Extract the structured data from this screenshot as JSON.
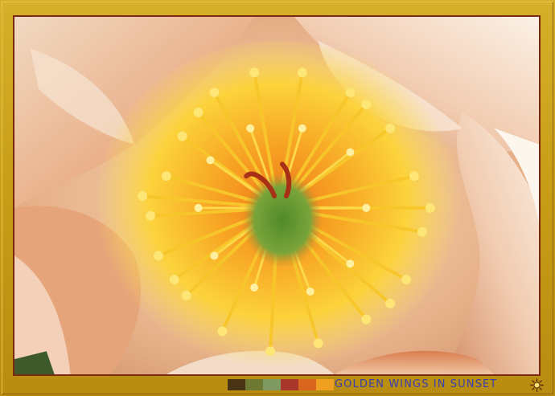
{
  "caption": {
    "text": "GOLDEN WINGS IN SUNSET",
    "color": "#3a3fb0"
  },
  "palette": [
    "#4a3214",
    "#6e7a34",
    "#7f9a62",
    "#a8362a",
    "#d8661e",
    "#f0a020"
  ],
  "frame": {
    "gold": "#c9a21a",
    "inner_border": "#7a2a10"
  },
  "photo": {
    "subject": "peony-flower-closeup",
    "icon": "sun-icon"
  }
}
